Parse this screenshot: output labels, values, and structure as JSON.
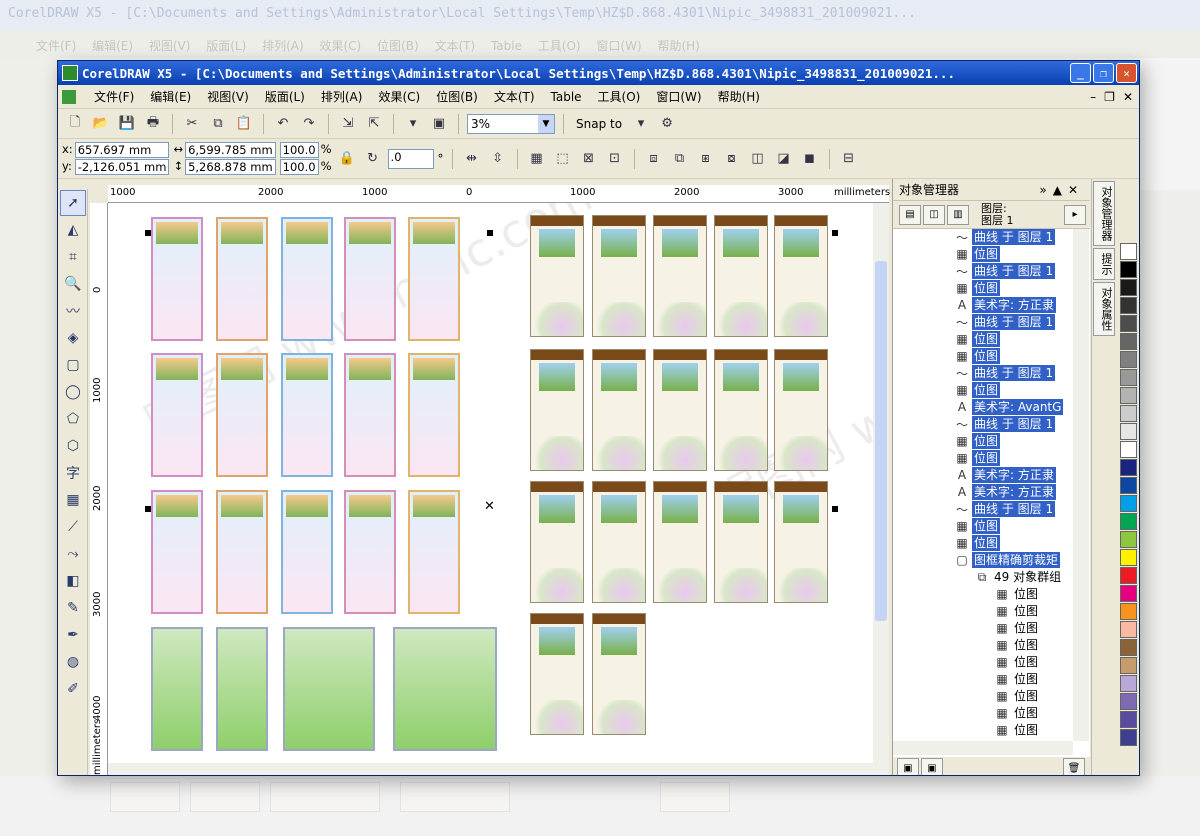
{
  "window": {
    "title": "CorelDRAW X5 - [C:\\Documents and Settings\\Administrator\\Local Settings\\Temp\\HZ$D.868.4301\\Nipic_3498831_201009021..."
  },
  "menu": [
    "文件(F)",
    "编辑(E)",
    "视图(V)",
    "版面(L)",
    "排列(A)",
    "效果(C)",
    "位图(B)",
    "文本(T)",
    "Table",
    "工具(O)",
    "窗口(W)",
    "帮助(H)"
  ],
  "toolbar": {
    "zoom": "3%",
    "snap": "Snap to"
  },
  "props": {
    "x": "657.697 mm",
    "y": "-2,126.051 mm",
    "w": "6,599.785 mm",
    "h": "5,268.878 mm",
    "sx": "100.0",
    "sy": "100.0",
    "pct": "%",
    "angle": ".0",
    "deg": "°"
  },
  "ruler": {
    "units": "millimeters",
    "h_ticks": [
      "1000",
      "2000",
      "1000",
      "0",
      "1000",
      "2000",
      "3000"
    ],
    "v_ticks": [
      "0",
      "1000",
      "2000",
      "3000",
      "4000"
    ],
    "v_units": "millimeters"
  },
  "panel": {
    "title": "对象管理器",
    "layer_label": "图层:",
    "layer_name": "图层 1",
    "items": [
      {
        "icon": "curve",
        "text": "曲线 于 图层 1",
        "sel": true,
        "indent": 0
      },
      {
        "icon": "bitmap",
        "text": "位图",
        "sel": true,
        "indent": 0
      },
      {
        "icon": "curve",
        "text": "曲线 于 图层 1",
        "sel": true,
        "indent": 0
      },
      {
        "icon": "bitmap",
        "text": "位图",
        "sel": true,
        "indent": 0
      },
      {
        "icon": "text",
        "text": "美术字: 方正隶",
        "sel": true,
        "indent": 0
      },
      {
        "icon": "curve",
        "text": "曲线 于 图层 1",
        "sel": true,
        "indent": 0
      },
      {
        "icon": "bitmap",
        "text": "位图",
        "sel": true,
        "indent": 0
      },
      {
        "icon": "bitmap",
        "text": "位图",
        "sel": true,
        "indent": 0
      },
      {
        "icon": "curve",
        "text": "曲线 于 图层 1",
        "sel": true,
        "indent": 0
      },
      {
        "icon": "bitmap",
        "text": "位图",
        "sel": true,
        "indent": 0
      },
      {
        "icon": "text",
        "text": "美术字: AvantG",
        "sel": true,
        "indent": 0
      },
      {
        "icon": "curve",
        "text": "曲线 于 图层 1",
        "sel": true,
        "indent": 0
      },
      {
        "icon": "bitmap",
        "text": "位图",
        "sel": true,
        "indent": 0
      },
      {
        "icon": "bitmap",
        "text": "位图",
        "sel": true,
        "indent": 0
      },
      {
        "icon": "text",
        "text": "美术字: 方正隶",
        "sel": true,
        "indent": 0
      },
      {
        "icon": "text",
        "text": "美术字: 方正隶",
        "sel": true,
        "indent": 0
      },
      {
        "icon": "curve",
        "text": "曲线 于 图层 1",
        "sel": true,
        "indent": 0
      },
      {
        "icon": "bitmap",
        "text": "位图",
        "sel": true,
        "indent": 0
      },
      {
        "icon": "bitmap",
        "text": "位图",
        "sel": true,
        "indent": 0
      },
      {
        "icon": "frame",
        "text": "图框精确剪裁矩",
        "sel": true,
        "indent": 0
      },
      {
        "icon": "group",
        "text": "49 对象群组",
        "sel": false,
        "indent": 1
      },
      {
        "icon": "bitmap",
        "text": "位图",
        "sel": false,
        "indent": 2
      },
      {
        "icon": "bitmap",
        "text": "位图",
        "sel": false,
        "indent": 2
      },
      {
        "icon": "bitmap",
        "text": "位图",
        "sel": false,
        "indent": 2
      },
      {
        "icon": "bitmap",
        "text": "位图",
        "sel": false,
        "indent": 2
      },
      {
        "icon": "bitmap",
        "text": "位图",
        "sel": false,
        "indent": 2
      },
      {
        "icon": "bitmap",
        "text": "位图",
        "sel": false,
        "indent": 2
      },
      {
        "icon": "bitmap",
        "text": "位图",
        "sel": false,
        "indent": 2
      },
      {
        "icon": "bitmap",
        "text": "位图",
        "sel": false,
        "indent": 2
      },
      {
        "icon": "bitmap",
        "text": "位图",
        "sel": false,
        "indent": 2
      }
    ]
  },
  "sidetabs": [
    "对象管理器",
    "提示",
    "对象属性"
  ],
  "bg": {
    "title": "CorelDRAW X5 - [C:\\Documents and Settings\\Administrator\\Local Settings\\Temp\\HZ$D.868.4301\\Nipic_3498831_201009021...",
    "menu": "文件(F) 编辑(E) 视图(V) 版面(L) 排列(A) 效果(C) 位图(B) 文本(T) Table 工具(O) 窗口(W) 帮助(H)"
  },
  "palette": [
    "#ffffff",
    "#000000",
    "#1a1a1a",
    "#333333",
    "#4d4d4d",
    "#666666",
    "#808080",
    "#999999",
    "#b3b3b3",
    "#cccccc",
    "#e6e6e6",
    "#ffffff",
    "#1a237e",
    "#0d47a1",
    "#00a0e9",
    "#00a651",
    "#8dc63f",
    "#fff200",
    "#ed1c24",
    "#e4007f",
    "#f7941d",
    "#f9b9a3",
    "#8c6239",
    "#c69c6d",
    "#b9a8d6",
    "#7e6ab3",
    "#5a4aa0",
    "#3f3f8f"
  ],
  "watermark": "昵图网 www.nipic.com"
}
